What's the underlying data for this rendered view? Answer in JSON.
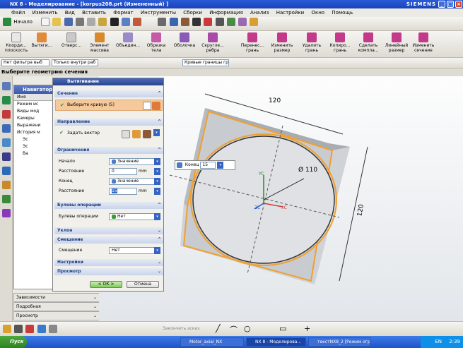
{
  "window": {
    "title": "NX 8 - Моделирование - [korpus208.prt (Измененный) ]",
    "brand": "SIEMENS"
  },
  "menu": [
    "Файл",
    "Изменить",
    "Вид",
    "Вставить",
    "Формат",
    "Инструменты",
    "Сборки",
    "Информация",
    "Анализ",
    "Настройки",
    "Окно",
    "Помощь"
  ],
  "toolbar": {
    "start_label": "Начало"
  },
  "commands": [
    {
      "label": "Коорди... плоскость"
    },
    {
      "label": "Вытяги..."
    },
    {
      "label": "Отверс..."
    },
    {
      "label": "Элемент массива"
    },
    {
      "label": "Объедин..."
    },
    {
      "label": "Обрезка тела"
    },
    {
      "label": "Оболочка"
    },
    {
      "label": "Скругле... ребра"
    },
    {
      "label": "Перенес... грань"
    },
    {
      "label": "Изменить размер"
    },
    {
      "label": "Удалить грань"
    },
    {
      "label": "Копиро... грань"
    },
    {
      "label": "Сделать компла..."
    },
    {
      "label": "Линейный размер"
    },
    {
      "label": "Изменить сечение"
    }
  ],
  "filters": {
    "type_filter": "Нет фильтра выб",
    "scope": "Только внутри раб",
    "curve_rule": "Кривые границы гр"
  },
  "selection_prompt": "Выберите геометрию сечения",
  "navigator": {
    "title": "Навигатор",
    "column": "Имя",
    "items": [
      "Режим ис",
      "Виды мод",
      "Камеры",
      "Выражени",
      "История м",
      "Эс",
      "Эс",
      "Ва"
    ],
    "bottom": [
      "Зависимости",
      "Подробная",
      "Просмотр"
    ]
  },
  "dialog": {
    "title": "Вытягивание",
    "section": {
      "header": "Сечение",
      "select_curve": "Выберите кривую (5)"
    },
    "direction": {
      "header": "Направление",
      "vector": "Задать вектор"
    },
    "limits": {
      "header": "Ограничения",
      "start_label": "Начало",
      "start_value": "Значение",
      "dist1_label": "Расстояние",
      "dist1_value": "0",
      "dist1_unit": "mm",
      "end_label": "Конец",
      "end_value": "Значение",
      "dist2_label": "Расстояние",
      "dist2_value": "15",
      "dist2_unit": "mm"
    },
    "boolean": {
      "header": "Булевы операции",
      "label": "Булевы операции",
      "value": "Нет"
    },
    "draft": {
      "header": "Уклон"
    },
    "offset": {
      "header": "Смещение",
      "label": "Смещение",
      "value": "Нет"
    },
    "settings": {
      "header": "Настройки"
    },
    "preview": {
      "header": "Просмотр"
    },
    "ok": "< ОК >",
    "cancel": "Отмена"
  },
  "float": {
    "label": "Конец",
    "value": "15"
  },
  "model": {
    "dim_top": "120",
    "dim_right": "120",
    "diameter": "Ø 110",
    "axis_xc": "XC",
    "axis_yc": "YC",
    "axis_zc": "ZC"
  },
  "sketch_btn": "Закончить эскиз",
  "taskbar": {
    "start": "Пуск",
    "tasks": [
      "Motor_axial_NX",
      "NX 8 - Моделирова...",
      "текстNX8_2 [Режим огр..."
    ],
    "lang": "EN",
    "clock": "2:39"
  }
}
